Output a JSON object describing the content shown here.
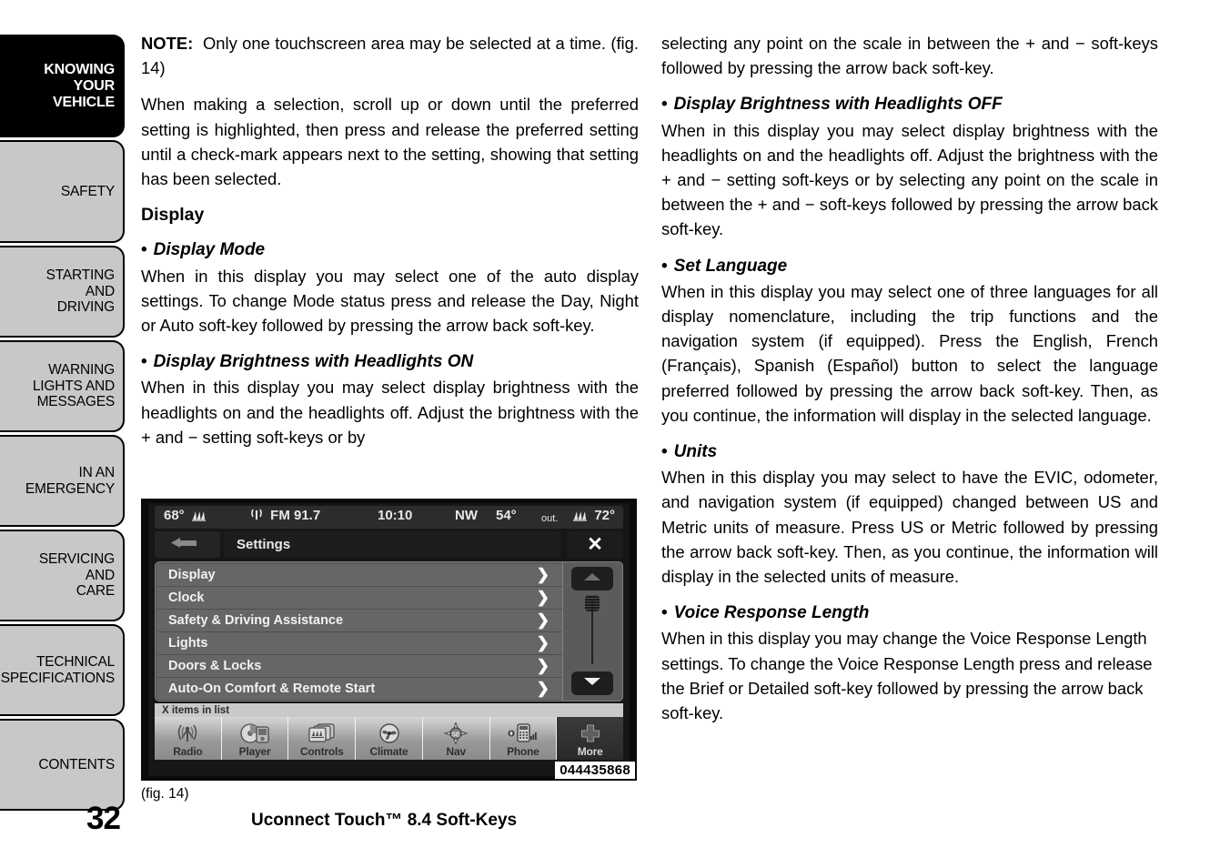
{
  "sidebar": {
    "tabs": [
      {
        "label": "KNOWING\nYOUR\nVEHICLE",
        "active": true,
        "size": "tall"
      },
      {
        "label": "SAFETY",
        "active": false,
        "size": "tall"
      },
      {
        "label": "STARTING\nAND\nDRIVING",
        "active": false,
        "size": "short"
      },
      {
        "label": "WARNING\nLIGHTS AND\nMESSAGES",
        "active": false,
        "size": "short"
      },
      {
        "label": "IN AN\nEMERGENCY",
        "active": false,
        "size": "short"
      },
      {
        "label": "SERVICING\nAND\nCARE",
        "active": false,
        "size": "short"
      },
      {
        "label": "TECHNICAL\nSPECIFICATIONS",
        "active": false,
        "size": "short"
      },
      {
        "label": "CONTENTS",
        "active": false,
        "size": "short"
      }
    ]
  },
  "page": {
    "number": "32",
    "running_footer": "Uconnect Touch™ 8.4 Soft-Keys"
  },
  "left_column": {
    "note_lead": "NOTE:",
    "note_text": "Only one touchscreen area may be selected at a time. (fig.  14)",
    "para_selection": "When making a selection, scroll up or down until the preferred setting is highlighted, then press and release the preferred setting until a check-mark appears next to the setting, showing that setting has been selected.",
    "section_heading": "Display",
    "bullet_display_mode": "Display Mode",
    "para_display_mode": "When in this display you may select one of the auto display settings. To change Mode status press and release the Day, Night or Auto soft-key followed by pressing the arrow back soft-key.",
    "bullet_brightness_on": "Display Brightness with Headlights ON",
    "para_brightness_on": "When in this display you may select display brightness with the headlights on and the headlights off. Adjust the brightness with the + and − setting soft-keys or by"
  },
  "right_column": {
    "para_continued": "selecting any point on the scale in between the + and − soft-keys followed by pressing the arrow back soft-key.",
    "bullet_brightness_off": "Display Brightness with Headlights OFF",
    "para_brightness_off": "When in this display you may select display brightness with the headlights on and the headlights off. Adjust the brightness with the + and − setting soft-keys or by selecting any point on the scale in between the + and − soft-keys followed by pressing the arrow back soft-key.",
    "bullet_set_language": "Set Language",
    "para_set_language": "When in this display you may select one of three languages for all display nomenclature, including the trip functions and the navigation system (if equipped). Press the English, French (Français), Spanish (Español) button to select the language preferred followed by pressing the arrow back soft-key. Then, as you continue, the information will display in the selected language.",
    "bullet_units": "Units",
    "para_units": "When in this display you may select to have the EVIC, odometer, and navigation system (if equipped) changed between US and Metric units of measure. Press US or Metric followed by pressing the arrow back soft-key. Then, as you continue, the information will display in the selected units of measure.",
    "bullet_voice_response": "Voice Response Length",
    "para_voice_response": "When in this display you may change the Voice Response Length settings. To change the Voice Response Length press and release the Brief or Detailed soft-key followed by pressing the arrow back soft-key."
  },
  "figure": {
    "caption": "(fig. 14)",
    "image_id": "044435868",
    "screen": {
      "status_bar": {
        "cabin_temp": "68°",
        "fan_icon": "fan-icon",
        "antenna_icon": "antenna-icon",
        "radio_band": "FM 91.7",
        "clock": "10:10",
        "compass": "NW",
        "outside_temp": "54°",
        "outside_label": "out.",
        "passenger_fan_icon": "fan-icon",
        "passenger_temp": "72°"
      },
      "back_key": "back-arrow-icon",
      "title": "Settings",
      "close_key": "✕",
      "list_items": [
        {
          "label": "Display",
          "chevron": "❯"
        },
        {
          "label": "Clock",
          "chevron": "❯"
        },
        {
          "label": "Safety & Driving Assistance",
          "chevron": "❯"
        },
        {
          "label": "Lights",
          "chevron": "❯"
        },
        {
          "label": "Doors & Locks",
          "chevron": "❯"
        },
        {
          "label": "Auto-On Comfort & Remote Start",
          "chevron": "❯"
        }
      ],
      "scroll": {
        "up_icon": "triangle-up-icon",
        "down_icon": "triangle-down-icon",
        "thumb": "scroll-thumb"
      },
      "items_in_list": "X items in list",
      "soft_keys": [
        {
          "label": "Radio",
          "icon": "radio-antenna-icon",
          "accent": false
        },
        {
          "label": "Player",
          "icon": "media-player-icon",
          "accent": false
        },
        {
          "label": "Controls",
          "icon": "controls-icon",
          "accent": false
        },
        {
          "label": "Climate",
          "icon": "climate-fan-icon",
          "accent": false
        },
        {
          "label": "Nav",
          "icon": "navigation-compass-icon",
          "accent": false
        },
        {
          "label": "Phone",
          "icon": "phone-icon",
          "accent": false
        },
        {
          "label": "More",
          "icon": "plus-icon",
          "accent": true
        }
      ]
    }
  }
}
